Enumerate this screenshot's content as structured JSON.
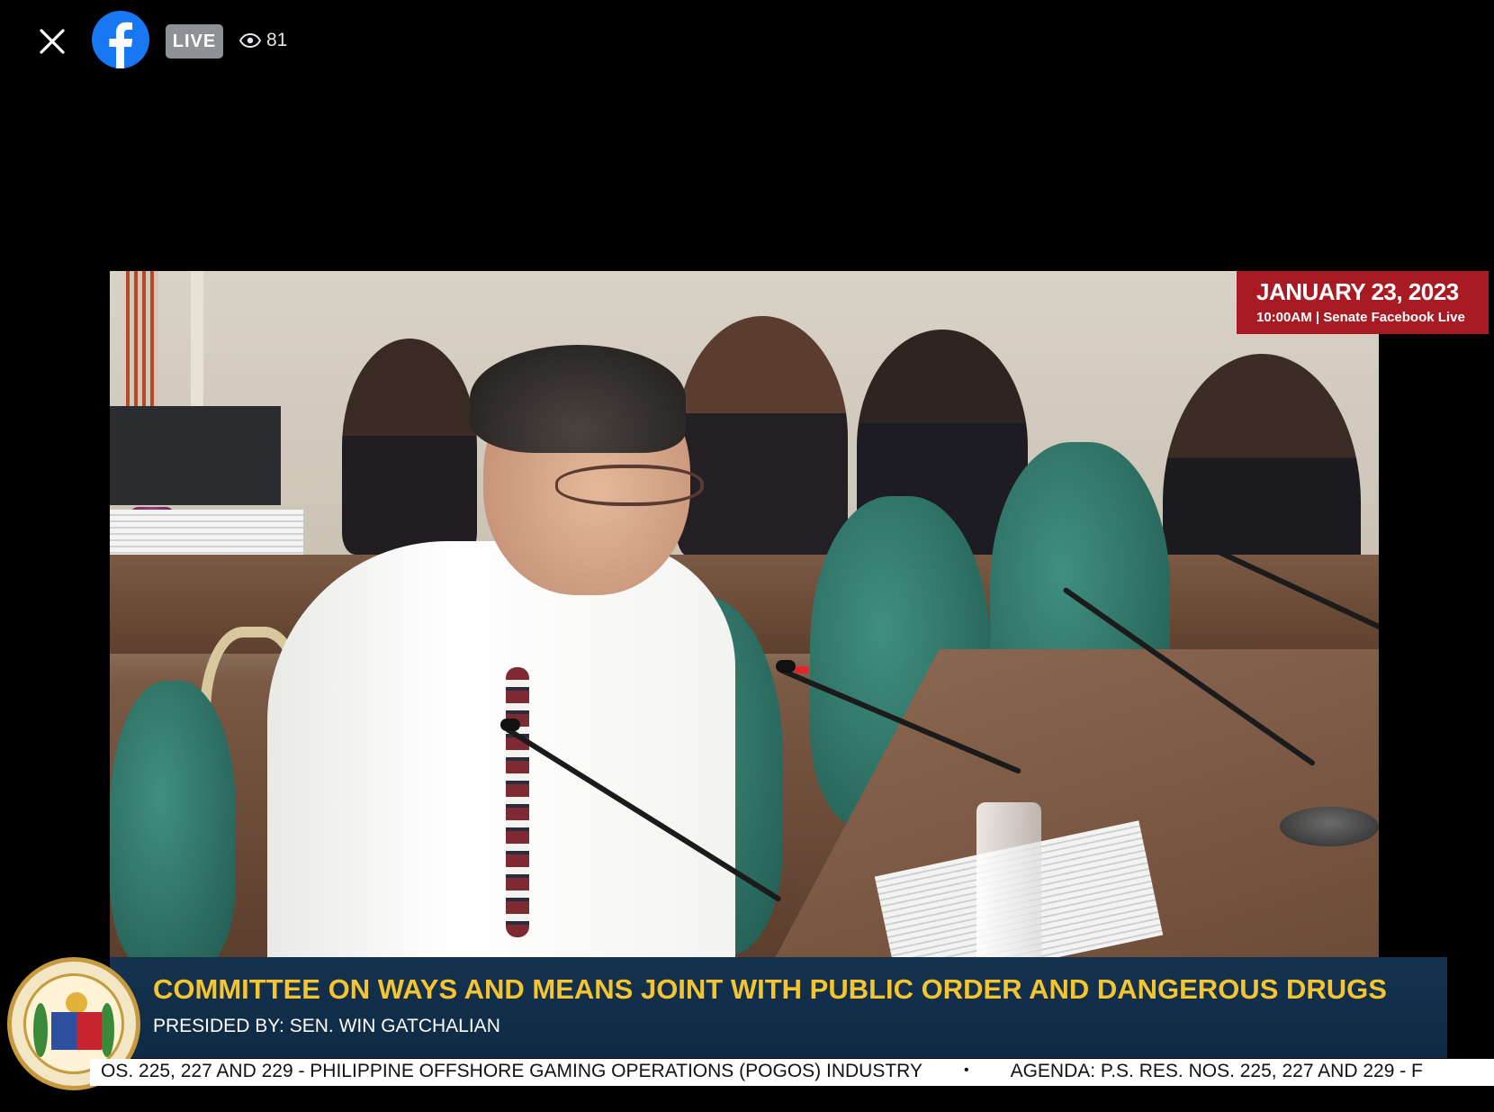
{
  "player": {
    "live_label": "LIVE",
    "viewer_count": "81",
    "icons": {
      "close": "close-icon",
      "logo": "facebook-logo-icon",
      "viewers": "eye-icon"
    },
    "colors": {
      "facebook_blue": "#1877f2",
      "live_badge": "#8e9196"
    }
  },
  "broadcast": {
    "date": "JANUARY 23, 2023",
    "date_sub": "10:00AM | Senate Facebook Live",
    "title": "COMMITTEE ON WAYS AND MEANS JOINT WITH PUBLIC ORDER AND DANGEROUS DRUGS",
    "presided_by": "PRESIDED BY: SEN. WIN GATCHALIAN",
    "seal_text": "SENATE OF THE PHILIPPINES · OFFICIAL SEAL",
    "ticker": {
      "item_1": "OS. 225, 227 AND 229 - PHILIPPINE OFFSHORE GAMING OPERATIONS (POGOS) INDUSTRY",
      "separator": "•",
      "item_2": "AGENDA: P.S. RES. NOS. 225, 227 AND 229 - F"
    },
    "colors": {
      "date_box": "#a91b22",
      "lower_third_bg": "#14324f",
      "title_yellow": "#f5c431"
    }
  }
}
